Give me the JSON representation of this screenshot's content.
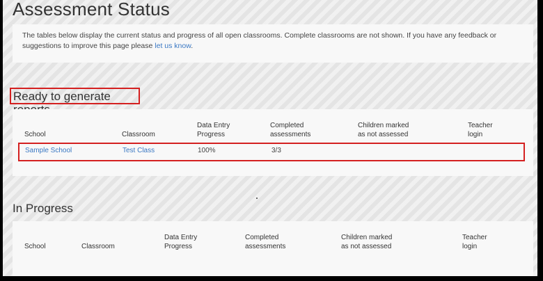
{
  "page": {
    "title": "Assessment Status",
    "intro_text": "The tables below display the current status and progress of all open classrooms. Complete classrooms are not shown. If you have any feedback or suggestions to improve this page please ",
    "intro_link": "let us know",
    "intro_end": "."
  },
  "ready": {
    "title": "Ready to generate reports",
    "headers": {
      "school": "School",
      "classroom": "Classroom",
      "progress_1": "Data Entry",
      "progress_2": "Progress",
      "completed_1": "Completed",
      "completed_2": "assessments",
      "not_assessed_1": "Children marked",
      "not_assessed_2": "as not assessed",
      "teacher_1": "Teacher",
      "teacher_2": "login"
    },
    "rows": [
      {
        "school": "Sample School",
        "classroom": "Test Class",
        "progress": "100%",
        "completed": "3/3"
      }
    ]
  },
  "in_progress": {
    "title": "In Progress",
    "headers": {
      "school": "School",
      "classroom": "Classroom",
      "progress_1": "Data Entry",
      "progress_2": "Progress",
      "completed_1": "Completed",
      "completed_2": "assessments",
      "not_assessed_1": "Children marked",
      "not_assessed_2": "as not assessed",
      "teacher_1": "Teacher",
      "teacher_2": "login"
    }
  }
}
